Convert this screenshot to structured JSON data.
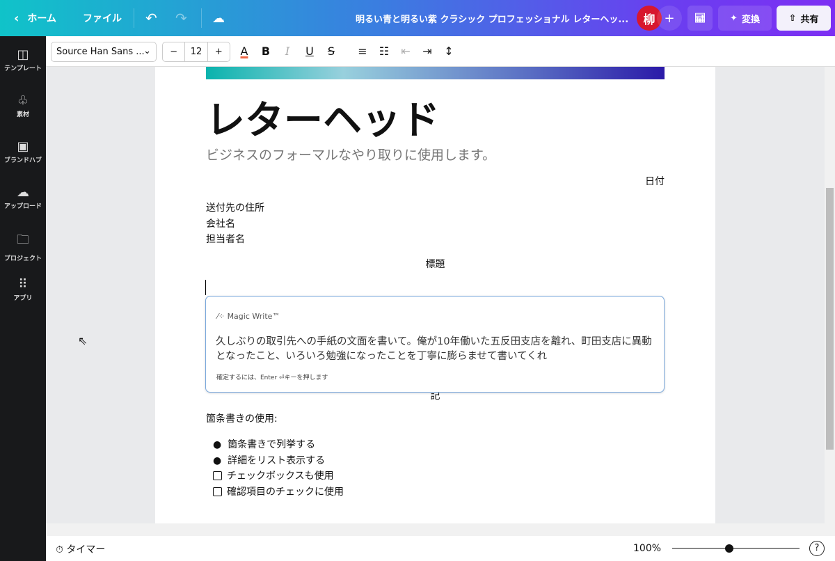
{
  "header": {
    "home": "ホーム",
    "file": "ファイル",
    "title": "明るい青と明るい紫 クラシック プロフェッショナル レターヘッ...",
    "avatar": "柳",
    "convert": "変換",
    "share": "共有"
  },
  "sidebar": {
    "items": [
      {
        "label": "テンプレート",
        "icon": "template-icon"
      },
      {
        "label": "素材",
        "icon": "elements-icon"
      },
      {
        "label": "ブランドハブ",
        "icon": "brand-icon"
      },
      {
        "label": "アップロード",
        "icon": "upload-icon"
      },
      {
        "label": "プロジェクト",
        "icon": "folder-icon"
      },
      {
        "label": "アプリ",
        "icon": "apps-icon"
      }
    ]
  },
  "toolbar": {
    "font": "Source Han Sans ...",
    "size": "12",
    "minus": "−",
    "plus": "+"
  },
  "document": {
    "heading": "レターヘッド",
    "subtitle": "ビジネスのフォーマルなやり取りに使用します。",
    "date": "日付",
    "address": [
      "送付先の住所",
      "会社名",
      "担当者名"
    ],
    "subject": "標題",
    "note": "記",
    "list_title": "箇条書きの使用:",
    "bullets": [
      "箇条書きで列挙する",
      "詳細をリスト表示する"
    ],
    "checks": [
      "チェックボックスも使用",
      "確認項目のチェックに使用"
    ]
  },
  "magic_write": {
    "label": "Magic Write™",
    "prompt": "久しぶりの取引先への手紙の文面を書いて。俺が10年働いた五反田支店を離れ、町田支店に異動となったこと、いろいろ勉強になったことを丁寧に膨らませて書いてくれ",
    "hint": "確定するには、Enter ⏎キーを押します"
  },
  "footer": {
    "timer": "タイマー",
    "zoom": "100%",
    "zoom_fraction": 0.45,
    "help": "?"
  }
}
